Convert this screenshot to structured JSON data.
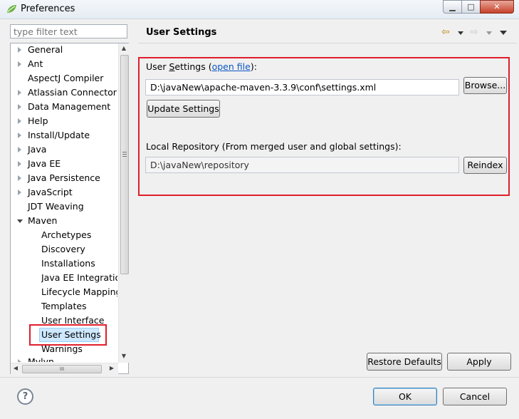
{
  "window": {
    "title": "Preferences",
    "min_glyph": "▁",
    "max_glyph": "□",
    "close_glyph": "✕"
  },
  "filter": {
    "placeholder": "type filter text"
  },
  "tree": {
    "items": [
      {
        "label": "General",
        "expanded": false
      },
      {
        "label": "Ant",
        "expanded": false
      },
      {
        "label": "AspectJ Compiler",
        "expanded": null
      },
      {
        "label": "Atlassian Connector",
        "expanded": false
      },
      {
        "label": "Data Management",
        "expanded": false
      },
      {
        "label": "Help",
        "expanded": false
      },
      {
        "label": "Install/Update",
        "expanded": false
      },
      {
        "label": "Java",
        "expanded": false
      },
      {
        "label": "Java EE",
        "expanded": false
      },
      {
        "label": "Java Persistence",
        "expanded": false
      },
      {
        "label": "JavaScript",
        "expanded": false
      },
      {
        "label": "JDT Weaving",
        "expanded": null
      },
      {
        "label": "Maven",
        "expanded": true
      }
    ],
    "maven_children": [
      "Archetypes",
      "Discovery",
      "Installations",
      "Java EE Integratio",
      "Lifecycle Mapping",
      "Templates",
      "User Interface",
      "User Settings",
      "Warnings"
    ],
    "partial_item": "Mylyn",
    "hscroll_thumb": "III"
  },
  "page": {
    "title": "User Settings",
    "user_settings_prefix": "User ",
    "user_settings_u": "S",
    "user_settings_suffix": "ettings (",
    "open_file_link": "open file",
    "user_settings_close": "):",
    "settings_path": "D:\\javaNew\\apache-maven-3.3.9\\conf\\settings.xml",
    "browse_label": "Browse...",
    "update_label": "Update Settings",
    "local_repo_label": "Local Repository (From merged user and global settings):",
    "repo_path": "D:\\javaNew\\repository",
    "reindex_label": "Reindex",
    "restore_label": "Restore Defaults",
    "apply_label": "Apply"
  },
  "footer": {
    "help_glyph": "?",
    "ok_label": "OK",
    "cancel_label": "Cancel"
  },
  "colors": {
    "annotation_red": "#e01e2c",
    "link_blue": "#0b55c4",
    "selection": "#cde8ff"
  }
}
